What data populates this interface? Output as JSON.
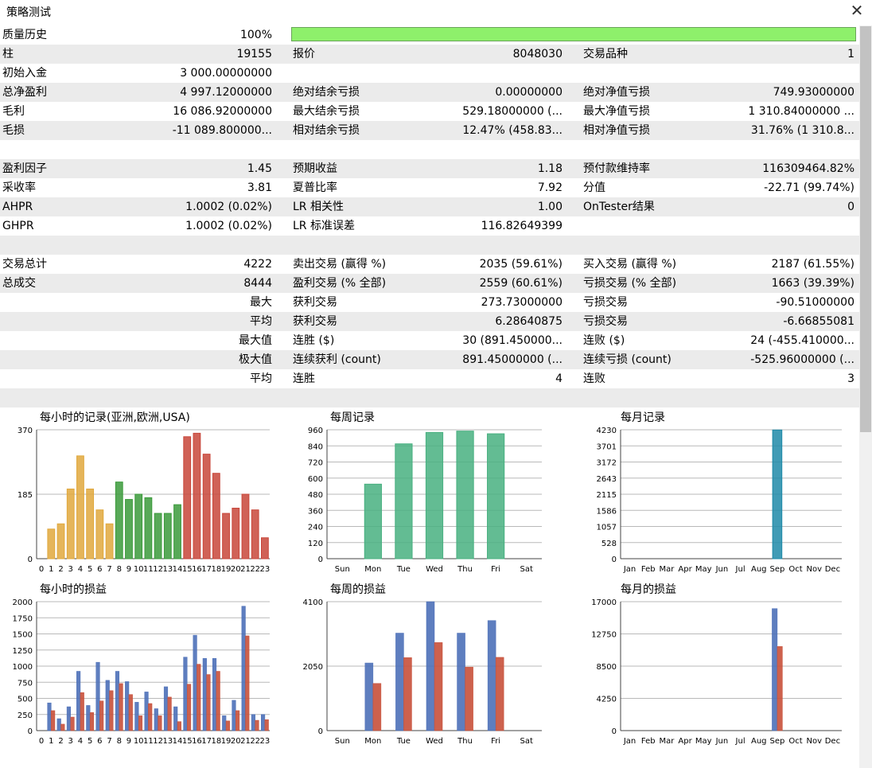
{
  "window": {
    "title": "策略测试"
  },
  "colors": {
    "quality_bar": "#8ef06b",
    "row_alt": "#ebebeb",
    "grid": "#b9b9b9",
    "hour_low": "#e0a83d",
    "hour_mid": "#3b9a3b",
    "hour_high": "#c8463a",
    "weekday_bar": "#48b080",
    "month_bar": "#1e8aa8",
    "profit_blue": "#4d70b8",
    "loss_red": "#c8503a"
  },
  "report": {
    "quality_label": "质量历史",
    "quality_value": "100%",
    "rows": [
      {
        "c0": "柱",
        "v0": "19155",
        "c1": "报价",
        "v1": "8048030",
        "c2": "交易品种",
        "v2": "1",
        "alt": true
      },
      {
        "c0": "初始入金",
        "v0": "3 000.00000000",
        "c1": "",
        "v1": "",
        "c2": "",
        "v2": "",
        "alt": false
      },
      {
        "c0": "总净盈利",
        "v0": "4 997.12000000",
        "c1": "绝对结余亏损",
        "v1": "0.00000000",
        "c2": "绝对净值亏损",
        "v2": "749.93000000",
        "alt": true
      },
      {
        "c0": "毛利",
        "v0": "16 086.92000000",
        "c1": "最大结余亏损",
        "v1": "529.18000000 (...",
        "c2": "最大净值亏损",
        "v2": "1 310.84000000 ...",
        "alt": false
      },
      {
        "c0": "毛损",
        "v0": "-11 089.800000...",
        "c1": "相对结余亏损",
        "v1": "12.47% (458.83...",
        "c2": "相对净值亏损",
        "v2": "31.76% (1 310.8...",
        "alt": true
      },
      {
        "c0": "",
        "v0": "",
        "c1": "",
        "v1": "",
        "c2": "",
        "v2": "",
        "alt": false
      },
      {
        "c0": "盈利因子",
        "v0": "1.45",
        "c1": "预期收益",
        "v1": "1.18",
        "c2": "预付款维持率",
        "v2": "116309464.82%",
        "alt": true
      },
      {
        "c0": "采收率",
        "v0": "3.81",
        "c1": "夏普比率",
        "v1": "7.92",
        "c2": "分值",
        "v2": "-22.71 (99.74%)",
        "alt": false
      },
      {
        "c0": "AHPR",
        "v0": "1.0002 (0.02%)",
        "c1": "LR 相关性",
        "v1": "1.00",
        "c2": "OnTester结果",
        "v2": "0",
        "alt": true
      },
      {
        "c0": "GHPR",
        "v0": "1.0002 (0.02%)",
        "c1": "LR 标准误差",
        "v1": "116.82649399",
        "c2": "",
        "v2": "",
        "alt": false
      },
      {
        "c0": "",
        "v0": "",
        "c1": "",
        "v1": "",
        "c2": "",
        "v2": "",
        "alt": true
      },
      {
        "c0": "交易总计",
        "v0": "4222",
        "c1": "卖出交易 (赢得 %)",
        "v1": "2035 (59.61%)",
        "c2": "买入交易 (赢得 %)",
        "v2": "2187 (61.55%)",
        "alt": false
      },
      {
        "c0": "总成交",
        "v0": "8444",
        "c1": "盈利交易 (% 全部)",
        "v1": "2559 (60.61%)",
        "c2": "亏损交易 (% 全部)",
        "v2": "1663 (39.39%)",
        "alt": true
      },
      {
        "c0": "",
        "v0": "最大",
        "c1": "获利交易",
        "v1": "273.73000000",
        "c2": "亏损交易",
        "v2": "-90.51000000",
        "alt": false
      },
      {
        "c0": "",
        "v0": "平均",
        "c1": "获利交易",
        "v1": "6.28640875",
        "c2": "亏损交易",
        "v2": "-6.66855081",
        "alt": true
      },
      {
        "c0": "",
        "v0": "最大值",
        "c1": "连胜 ($)",
        "v1": "30 (891.450000...",
        "c2": "连败 ($)",
        "v2": "24 (-455.410000...",
        "alt": false
      },
      {
        "c0": "",
        "v0": "极大值",
        "c1": "连续获利 (count)",
        "v1": "891.45000000 (...",
        "c2": "连续亏损 (count)",
        "v2": "-525.96000000 (...",
        "alt": true
      },
      {
        "c0": "",
        "v0": "平均",
        "c1": "连胜",
        "v1": "4",
        "c2": "连败",
        "v2": "3",
        "alt": false
      },
      {
        "c0": "",
        "v0": "",
        "c1": "",
        "v1": "",
        "c2": "",
        "v2": "",
        "alt": true
      }
    ]
  },
  "chart_data": [
    {
      "type": "bar",
      "title": "每小时的记录(亚洲,欧洲,USA)",
      "categories": [
        "0",
        "1",
        "2",
        "3",
        "4",
        "5",
        "6",
        "7",
        "8",
        "9",
        "10",
        "11",
        "12",
        "13",
        "14",
        "15",
        "16",
        "17",
        "18",
        "19",
        "20",
        "21",
        "22",
        "23"
      ],
      "values": [
        0,
        85,
        100,
        200,
        295,
        200,
        140,
        100,
        220,
        170,
        185,
        175,
        130,
        130,
        155,
        350,
        360,
        300,
        245,
        130,
        145,
        185,
        140,
        60
      ],
      "y_ticks": [
        "370",
        "185",
        "0"
      ],
      "ylim": [
        0,
        370
      ]
    },
    {
      "type": "bar",
      "title": "每周记录",
      "categories": [
        "Sun",
        "Mon",
        "Tue",
        "Wed",
        "Thu",
        "Fri",
        "Sat"
      ],
      "values": [
        0,
        555,
        855,
        940,
        950,
        930,
        0
      ],
      "y_ticks": [
        "960",
        "840",
        "720",
        "600",
        "480",
        "360",
        "240",
        "120",
        "0"
      ],
      "ylim": [
        0,
        960
      ]
    },
    {
      "type": "bar",
      "title": "每月记录",
      "categories": [
        "Jan",
        "Feb",
        "Mar",
        "Apr",
        "May",
        "Jun",
        "Jul",
        "Aug",
        "Sep",
        "Oct",
        "Nov",
        "Dec"
      ],
      "values": [
        0,
        0,
        0,
        0,
        0,
        0,
        0,
        0,
        4222,
        0,
        0,
        0
      ],
      "y_ticks": [
        "4230",
        "3701",
        "3172",
        "2643",
        "2115",
        "1586",
        "1057",
        "528",
        "0"
      ],
      "ylim": [
        0,
        4230
      ]
    },
    {
      "type": "bar",
      "title": "每小时的损益",
      "categories": [
        "0",
        "1",
        "2",
        "3",
        "4",
        "5",
        "6",
        "7",
        "8",
        "9",
        "10",
        "11",
        "12",
        "13",
        "14",
        "15",
        "16",
        "17",
        "18",
        "19",
        "20",
        "21",
        "22",
        "23"
      ],
      "series": [
        {
          "values": [
            0,
            430,
            185,
            370,
            920,
            390,
            1060,
            780,
            920,
            760,
            440,
            600,
            340,
            680,
            370,
            1140,
            1480,
            1120,
            1120,
            230,
            470,
            1930,
            250,
            250
          ]
        },
        {
          "values": [
            0,
            310,
            100,
            210,
            590,
            280,
            460,
            620,
            730,
            560,
            230,
            420,
            230,
            520,
            140,
            720,
            1030,
            870,
            920,
            150,
            310,
            1470,
            160,
            170
          ]
        }
      ],
      "y_ticks": [
        "2000",
        "1750",
        "1500",
        "1250",
        "1000",
        "750",
        "500",
        "250",
        "0"
      ],
      "ylim": [
        0,
        2000
      ]
    },
    {
      "type": "bar",
      "title": "每周的损益",
      "categories": [
        "Sun",
        "Mon",
        "Tue",
        "Wed",
        "Thu",
        "Fri",
        "Sat"
      ],
      "series": [
        {
          "values": [
            0,
            2150,
            3100,
            4100,
            3100,
            3500,
            0
          ]
        },
        {
          "values": [
            0,
            1500,
            2320,
            2800,
            2020,
            2330,
            0
          ]
        }
      ],
      "y_ticks": [
        "4100",
        "2050",
        "0"
      ],
      "ylim": [
        0,
        4100
      ]
    },
    {
      "type": "bar",
      "title": "每月的损益",
      "categories": [
        "Jan",
        "Feb",
        "Mar",
        "Apr",
        "May",
        "Jun",
        "Jul",
        "Aug",
        "Sep",
        "Oct",
        "Nov",
        "Dec"
      ],
      "series": [
        {
          "values": [
            0,
            0,
            0,
            0,
            0,
            0,
            0,
            0,
            16087,
            0,
            0,
            0
          ]
        },
        {
          "values": [
            0,
            0,
            0,
            0,
            0,
            0,
            0,
            0,
            11090,
            0,
            0,
            0
          ]
        }
      ],
      "y_ticks": [
        "17000",
        "12750",
        "8500",
        "4250",
        "0"
      ],
      "ylim": [
        0,
        17000
      ]
    }
  ]
}
